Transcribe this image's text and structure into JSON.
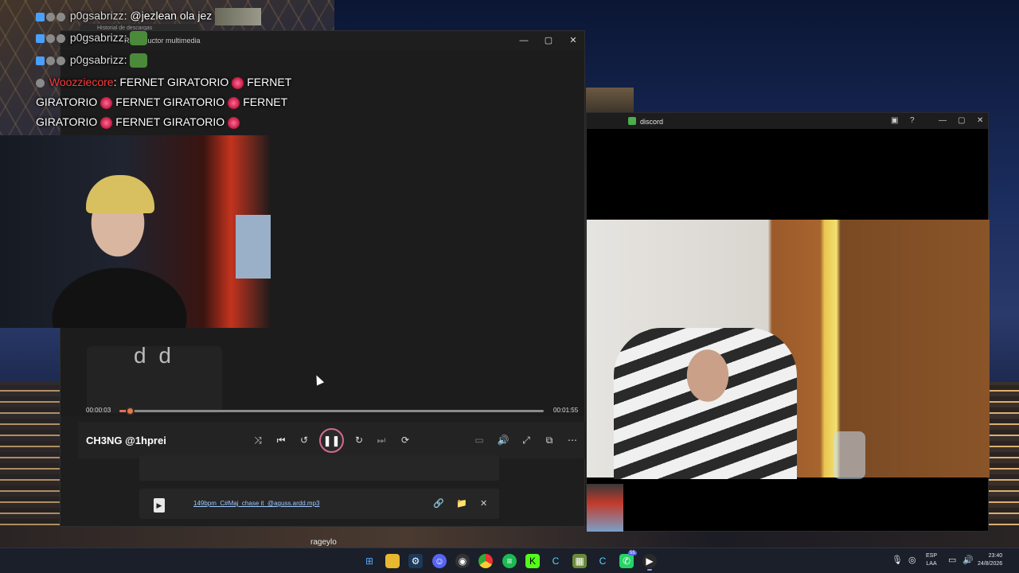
{
  "player": {
    "title": "Reproductor multimedia",
    "behind_tab_title": "Historial de descargas",
    "overlay_text": "d d",
    "elapsed": "00:00:03",
    "total": "00:01:55",
    "progress_fraction": 0.026,
    "track_title": "CH3NG @1hprei",
    "playlist": [
      {
        "file_name": "149bpm_C#Maj_chase it_@aguss.ardd.mp3"
      }
    ],
    "window_controls": {
      "minimize": "—",
      "maximize": "▢",
      "close": "✕"
    },
    "controls": {
      "shuffle": "⤨",
      "previous": "⏮",
      "rewind": "↺",
      "play_pause": "❚❚",
      "forward": "↻",
      "next": "⏭",
      "repeat": "⟳",
      "miniplayer": "▭",
      "volume": "🔊",
      "fullscreen": "⤢",
      "cast": "⧉",
      "more": "⋯"
    },
    "row_icons": {
      "link": "🔗",
      "folder": "📁",
      "remove": "✕"
    }
  },
  "chat": {
    "messages": [
      {
        "user": "p0gsabrizz",
        "text": ": @jezlean ola jez"
      },
      {
        "user": "p0gsabrizz",
        "text": ":"
      },
      {
        "user": "p0gsabrizz",
        "text": ":"
      },
      {
        "user": "Woozziecore",
        "text": ": FERNET GIRATORIO",
        "tail": "FERNET"
      },
      {
        "text": "GIRATORIO",
        "mid": "FERNET GIRATORIO",
        "tail": "FERNET"
      },
      {
        "text": "GIRATORIO",
        "mid": "FERNET GIRATORIO"
      }
    ]
  },
  "discord": {
    "title": "discord",
    "controls": {
      "inbox": "▣",
      "help": "?",
      "minimize": "—",
      "maximize": "▢",
      "close": "✕"
    },
    "bottom_user": "rageylo"
  },
  "taskbar": {
    "icons": [
      "start-icon",
      "file-explorer-icon",
      "steam-icon",
      "discord-icon",
      "obs-icon",
      "chrome-icon",
      "spotify-icon",
      "kick-icon",
      "ccleaner-icon",
      "minecraft-icon",
      "ccleaner2-icon",
      "whatsapp-icon",
      "media-player-icon"
    ],
    "whatsapp_badge": "55",
    "lang_top": "ESP",
    "lang_bottom": "LAA",
    "time": "23:40",
    "date": "24/8/2026"
  },
  "colors": {
    "accent": "#e07050",
    "play_ring": "#d46a8a",
    "chat_user": "#ff3a3a",
    "link": "#9cc7ff"
  }
}
